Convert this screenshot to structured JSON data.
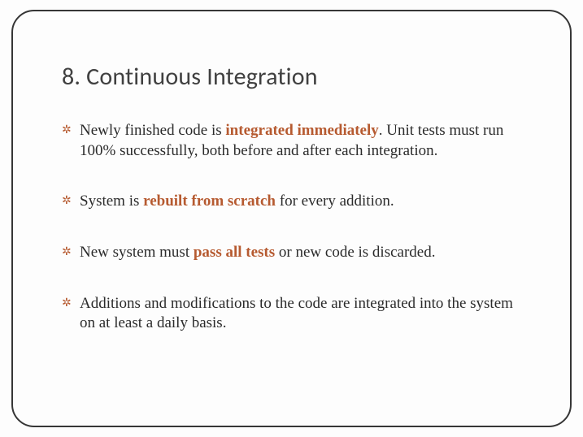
{
  "title": "8. Continuous Integration",
  "bullets": {
    "b1": {
      "pre": "Newly finished code is ",
      "accent": "integrated immediately",
      "post": ". Unit tests must run 100% successfully, both before and after each integration."
    },
    "b2": {
      "pre": "System is ",
      "accent": "rebuilt from scratch",
      "post": " for every addition."
    },
    "b3": {
      "pre": "New system must ",
      "accent": "pass all tests",
      "post": " or new code is discarded."
    },
    "b4": {
      "pre": "Additions and modifications to the code are integrated into the system on at least a daily basis.",
      "accent": "",
      "post": ""
    }
  }
}
